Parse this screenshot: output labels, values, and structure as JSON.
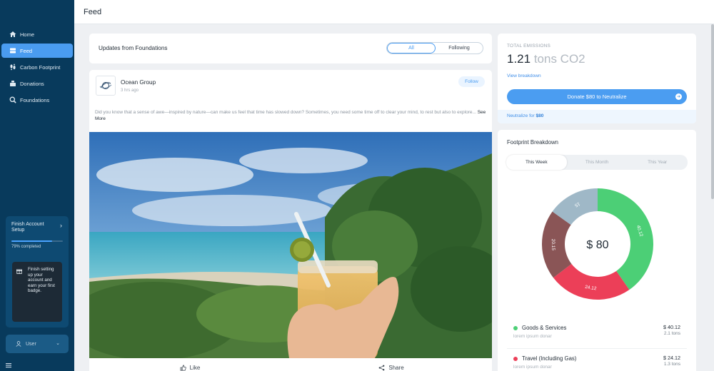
{
  "header": {
    "title": "Feed"
  },
  "sidebar": {
    "items": [
      {
        "label": "Home",
        "icon": "home-icon"
      },
      {
        "label": "Feed",
        "icon": "feed-icon",
        "active": true
      },
      {
        "label": "Carbon Footprint",
        "icon": "footprint-icon"
      },
      {
        "label": "Donations",
        "icon": "donations-icon"
      },
      {
        "label": "Foundations",
        "icon": "foundations-icon"
      }
    ],
    "finish_card": {
      "title": "Finish Account Setup",
      "progress_percent": 79,
      "progress_text": "79% completed",
      "badge_text": "Finish setting up your account and earn your first badge."
    },
    "user": {
      "label": "User"
    }
  },
  "feed": {
    "header_title": "Updates from Foundations",
    "filter": {
      "all": "All",
      "following": "Following",
      "selected": "All"
    },
    "post": {
      "org": "Ocean Group",
      "time": "3 hrs ago",
      "follow_label": "Follow",
      "body": "Did you know that a sense of awe—inspired by nature—can make us feel that time has slowed down? Sometimes, you need some time off to clear your mind, to rest but also to explore...",
      "see_more": "See More",
      "like_label": "Like",
      "share_label": "Share"
    }
  },
  "emissions": {
    "label": "TOTAL EMISSIONS",
    "value": "1.21",
    "unit": "tons CO2",
    "breakdown_link": "View breakdown",
    "donate_label": "Donate $80 to Neutralize",
    "neutralize_prefix": "Neutralize for",
    "neutralize_amount": "$80"
  },
  "breakdown": {
    "title": "Footprint Breakdown",
    "tabs": [
      "This Week",
      "This Month",
      "This Year"
    ],
    "selected_tab": "This Week",
    "center_label": "$ 80",
    "categories": [
      {
        "name": "Goods & Services",
        "sub": "lorem ipsum donar",
        "amount": "$ 40.12",
        "tons": "2.1 tons",
        "color": "#4ccf76"
      },
      {
        "name": "Travel (Including Gas)",
        "sub": "lorem ipsum donar",
        "amount": "$ 24.12",
        "tons": "1.3 tons",
        "color": "#ec3f58"
      }
    ],
    "slices": [
      {
        "label": "40.12",
        "value": 40.12,
        "color": "#4ccf76"
      },
      {
        "label": "24.12",
        "value": 24.12,
        "color": "#ec3f58"
      },
      {
        "label": "20.15",
        "value": 20.15,
        "color": "#8a5556"
      },
      {
        "label": "15",
        "value": 15,
        "color": "#9fb8c7"
      }
    ]
  },
  "colors": {
    "sidebar": "#083a5c",
    "accent": "#4b9df1",
    "active_nav": "#4a9cf0"
  }
}
